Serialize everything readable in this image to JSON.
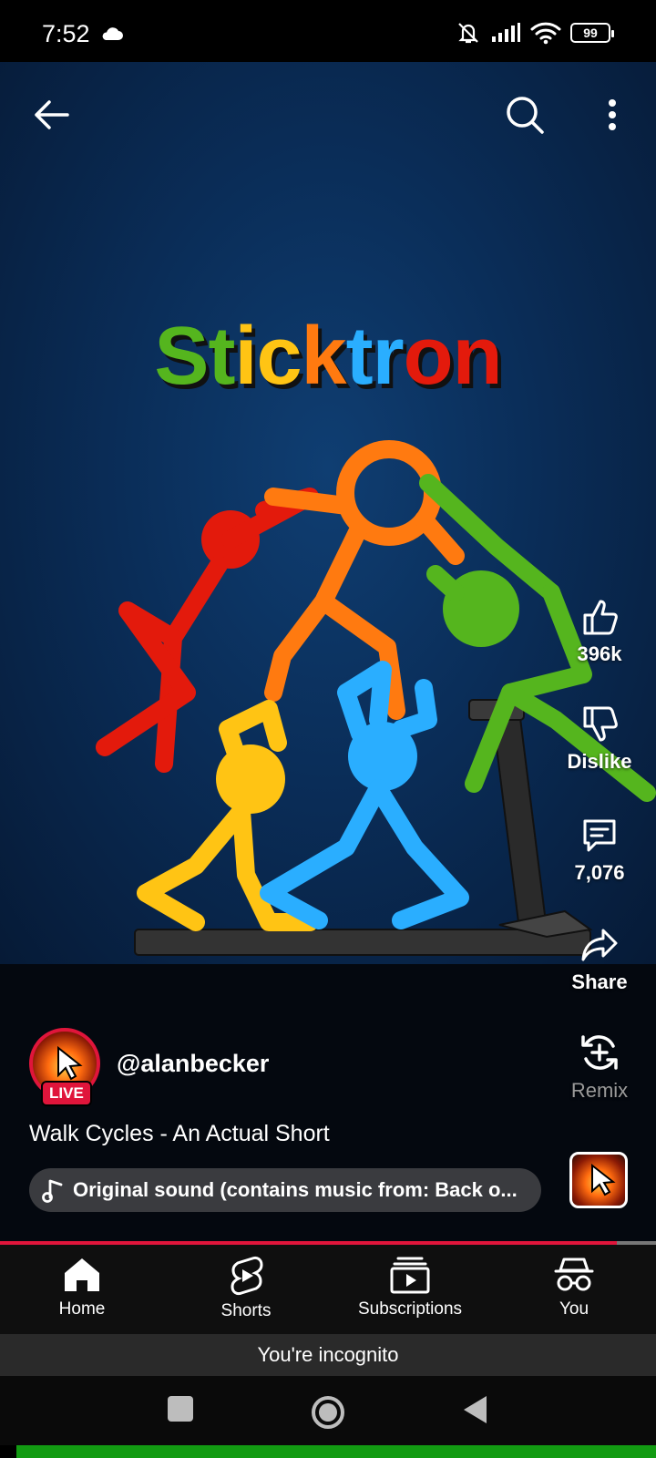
{
  "status_bar": {
    "time": "7:52",
    "battery": "99"
  },
  "video": {
    "title_art_letters": [
      "S",
      "t",
      "i",
      "c",
      "k",
      "t",
      "r",
      "o",
      "n"
    ],
    "title_art_colors": [
      "#55b51e",
      "#55b51e",
      "#ffc414",
      "#ffc414",
      "#ff7a10",
      "#2aaeff",
      "#2aaeff",
      "#e31a0c",
      "#e31a0c"
    ]
  },
  "actions": {
    "like_count": "396k",
    "dislike_label": "Dislike",
    "comment_count": "7,076",
    "share_label": "Share",
    "remix_label": "Remix"
  },
  "channel": {
    "handle": "@alanbecker",
    "live_badge": "LIVE"
  },
  "video_title": "Walk Cycles - An Actual Short",
  "sound": {
    "text": "Original sound (contains music from: Back o..."
  },
  "progress": 0.94,
  "bottom_nav": {
    "items": [
      {
        "label": "Home",
        "icon": "home-icon"
      },
      {
        "label": "Shorts",
        "icon": "shorts-icon"
      },
      {
        "label": "Subscriptions",
        "icon": "subscriptions-icon"
      },
      {
        "label": "You",
        "icon": "incognito-icon"
      }
    ]
  },
  "incognito_text": "You're incognito",
  "colors": {
    "accent_red": "#e0153b",
    "green": "#55b51e",
    "yellow": "#ffc414",
    "orange": "#ff7a10",
    "blue": "#2aaeff",
    "red": "#e31a0c"
  }
}
